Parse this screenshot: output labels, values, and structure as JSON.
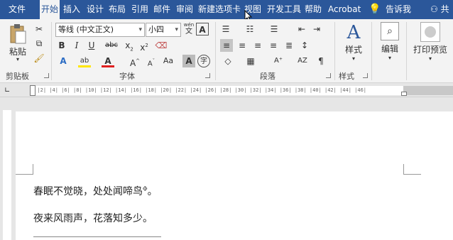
{
  "tabs": [
    "文件",
    "开始",
    "插入",
    "设计",
    "布局",
    "引用",
    "邮件",
    "审阅",
    "新建选项卡",
    "视图",
    "开发工具",
    "帮助",
    "Acrobat",
    "告诉我",
    "共"
  ],
  "active_tab": "开始",
  "clipboard": {
    "paste": "粘贴",
    "label": "剪贴板"
  },
  "font": {
    "name": "等线 (中文正文)",
    "size": "小四",
    "wen": "wén",
    "label": "字体"
  },
  "paragraph": {
    "label": "段落"
  },
  "styles": {
    "button": "样式",
    "label": "样式"
  },
  "editing": {
    "button": "编辑"
  },
  "print": {
    "button": "打印预览"
  },
  "ruler_marks": "|  |2|  |4|  |6|  |8|  |10|  |12|  |14|  |16|  |18|  |20|  |22|  |24|  |26|  |28|  |30|  |32|  |34|  |36|  |38|  |40|  |42|  |44|  |46|",
  "document": {
    "line1": "春眠不觉晓，处处闻啼鸟",
    "line1_mark": "Φ",
    "line1_end": "。",
    "line2": "夜来风雨声，花落知多少。"
  },
  "colors": {
    "tab_bar": "#2b579a",
    "ribbon": "#f3f3f3"
  }
}
